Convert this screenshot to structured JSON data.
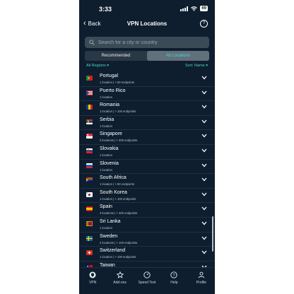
{
  "status_bar": {
    "time": "3:33",
    "battery": "69"
  },
  "nav": {
    "back_label": "Back",
    "title": "VPN Locations"
  },
  "search": {
    "placeholder": "Search for a city or country"
  },
  "segments": [
    {
      "label": "Recommended"
    },
    {
      "label": "All Locations"
    }
  ],
  "filters": {
    "region_label": "All Regions ▾",
    "sort_label": "Sort: Name ▾"
  },
  "accent_color": "#46d7c2",
  "countries": [
    {
      "name": "Portugal",
      "detail": "1 location  |  >  50 endpoints",
      "flag": "portugal-flag-icon"
    },
    {
      "name": "Puerto Rico",
      "detail": "1 location",
      "flag": "puerto-rico-flag-icon"
    },
    {
      "name": "Romania",
      "detail": "1 location  |  >  100 endpoints",
      "flag": "romania-flag-icon"
    },
    {
      "name": "Serbia",
      "detail": "1 location",
      "flag": "serbia-flag-icon"
    },
    {
      "name": "Singapore",
      "detail": "3 locations  |  >  300 endpoints",
      "flag": "singapore-flag-icon"
    },
    {
      "name": "Slovakia",
      "detail": "1 location",
      "flag": "slovakia-flag-icon"
    },
    {
      "name": "Slovenia",
      "detail": "1 location",
      "flag": "slovenia-flag-icon"
    },
    {
      "name": "South Africa",
      "detail": "1 location  |  >  50 endpoints",
      "flag": "south-africa-flag-icon"
    },
    {
      "name": "South Korea",
      "detail": "1 location  |  >  100 endpoints",
      "flag": "south-korea-flag-icon"
    },
    {
      "name": "Spain",
      "detail": "3 locations  |  >  300 endpoints",
      "flag": "spain-flag-icon"
    },
    {
      "name": "Sri Lanka",
      "detail": "1 location",
      "flag": "sri-lanka-flag-icon"
    },
    {
      "name": "Sweden",
      "detail": "2 locations  |  >  100 endpoints",
      "flag": "sweden-flag-icon"
    },
    {
      "name": "Switzerland",
      "detail": "1 location  |  >  100 endpoints",
      "flag": "switzerland-flag-icon"
    },
    {
      "name": "Taiwan",
      "detail": "1 location  |  >  50 endpoints",
      "flag": "taiwan-flag-icon"
    }
  ],
  "tabs": [
    {
      "label": "VPN",
      "icon": "vpn-icon"
    },
    {
      "label": "Add-ons",
      "icon": "star-icon"
    },
    {
      "label": "Speed Test",
      "icon": "speedometer-icon"
    },
    {
      "label": "Help",
      "icon": "help-icon"
    },
    {
      "label": "Profile",
      "icon": "profile-icon"
    }
  ]
}
